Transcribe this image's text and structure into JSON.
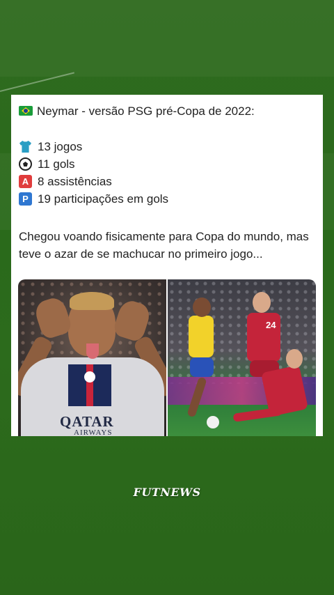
{
  "post": {
    "title": "Neymar - versão PSG pré-Copa de 2022:",
    "stats": [
      {
        "icon": "shirt-icon",
        "text": "13 jogos"
      },
      {
        "icon": "soccer-ball-icon",
        "text": "11 gols"
      },
      {
        "icon": "letter-a-icon",
        "text": "8 assistências"
      },
      {
        "icon": "letter-p-icon",
        "text": "19 participações em gols"
      }
    ],
    "body": "Chegou voando fisicamente para Copa do mundo, mas teve o azar de se machucar no primeiro jogo...",
    "left_photo_text": {
      "sponsor": "QATAR",
      "sponsor_sub": "AIRWAYS"
    },
    "right_photo_text": {
      "shirt_number": "24"
    }
  },
  "branding": {
    "watermark": "FUTNEWS"
  },
  "colors": {
    "background": "#2c6b1c",
    "card": "#ffffff",
    "icon_a": "#e03c3c",
    "icon_p": "#2f77d1"
  }
}
